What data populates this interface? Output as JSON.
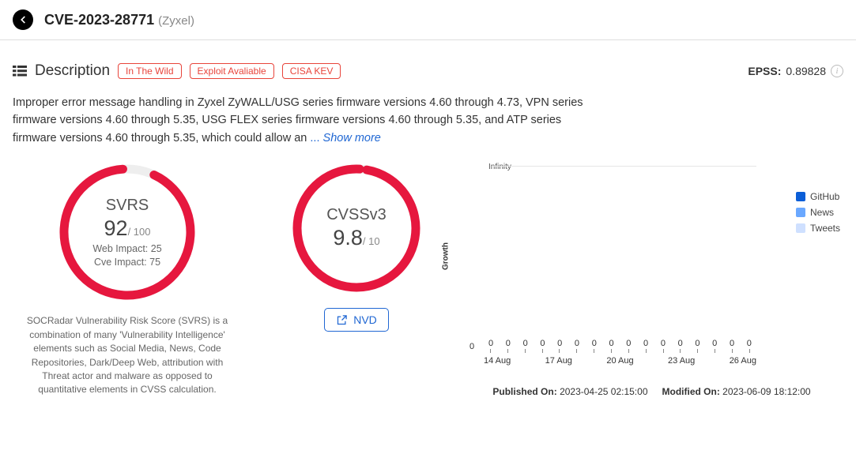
{
  "header": {
    "cve_id": "CVE-2023-28771",
    "vendor": "(Zyxel)"
  },
  "section": {
    "title": "Description",
    "badges": [
      "In The Wild",
      "Exploit Avaliable",
      "CISA KEV"
    ],
    "epss_label": "EPSS:",
    "epss_value": "0.89828"
  },
  "description": "Improper error message handling in Zyxel ZyWALL/USG series firmware versions 4.60 through 4.73, VPN series firmware versions 4.60 through 5.35, USG FLEX series firmware versions 4.60 through 5.35, and ATP series firmware versions 4.60 through 5.35, which could allow an",
  "show_more": "Show more",
  "svrs": {
    "label": "SVRS",
    "value": "92",
    "max": "/ 100",
    "web_impact": "Web Impact: 25",
    "cve_impact": "Cve Impact: 75",
    "desc": "SOCRadar Vulnerability Risk Score (SVRS) is a combination of many 'Vulnerability Intelligence' elements such as Social Media, News, Code Repositories, Dark/Deep Web, attribution with Threat actor and malware as opposed to quantitative elements in CVSS calculation."
  },
  "cvss": {
    "label": "CVSSv3",
    "value": "9.8",
    "max": "/ 10",
    "nvd_label": "NVD"
  },
  "chart_data": {
    "type": "line",
    "title": "",
    "ylabel": "Growth",
    "y_top": "Infinity",
    "y_bottom": "0",
    "series_values": [
      "0",
      "0",
      "0",
      "0",
      "0",
      "0",
      "0",
      "0",
      "0",
      "0",
      "0",
      "0",
      "0",
      "0",
      "0",
      "0"
    ],
    "x_ticks": [
      "14 Aug",
      "17 Aug",
      "20 Aug",
      "23 Aug",
      "26 Aug"
    ],
    "legend": [
      {
        "name": "GitHub",
        "color": "#0b5ed7"
      },
      {
        "name": "News",
        "color": "#6aa8ff"
      },
      {
        "name": "Tweets",
        "color": "#cfe0ff"
      }
    ]
  },
  "dates": {
    "published_label": "Published On:",
    "published_value": "2023-04-25 02:15:00",
    "modified_label": "Modified On:",
    "modified_value": "2023-06-09 18:12:00"
  }
}
